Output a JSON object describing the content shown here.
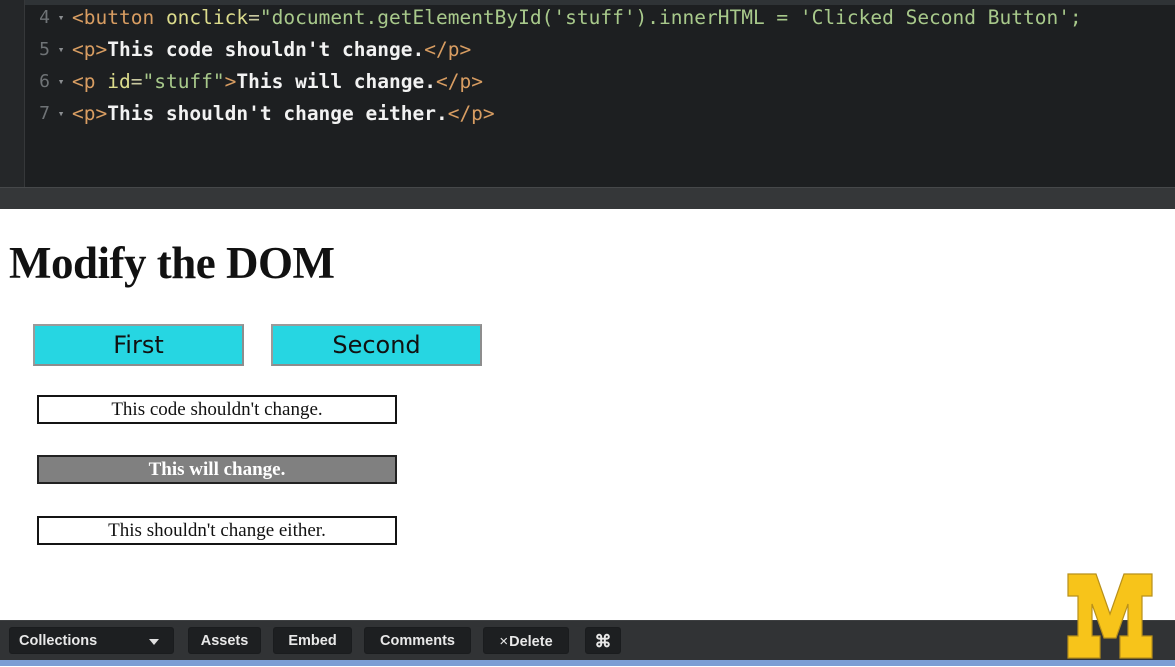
{
  "editor": {
    "lines": [
      {
        "number": "4",
        "fold": "▾",
        "tokens": [
          {
            "type": "tag",
            "text": "<button"
          },
          {
            "type": "text_space",
            "text": " "
          },
          {
            "type": "attr",
            "text": "onclick"
          },
          {
            "type": "op",
            "text": "="
          },
          {
            "type": "str",
            "text": "\"document.getElementById('stuff').innerHTML = 'Clicked Second Button';"
          }
        ],
        "plain": "<button onclick=\"document.getElementById('stuff').innerHTML = 'Clicked Second Button';"
      },
      {
        "number": "5",
        "fold": "▾",
        "tokens": [
          {
            "type": "tag",
            "text": "<p>"
          },
          {
            "type": "text",
            "text": "This code shouldn't change."
          },
          {
            "type": "tag",
            "text": "</p>"
          }
        ],
        "plain": "<p>This code shouldn't change.</p>"
      },
      {
        "number": "6",
        "fold": "▾",
        "tokens": [
          {
            "type": "tag",
            "text": "<p"
          },
          {
            "type": "text_space",
            "text": " "
          },
          {
            "type": "attr",
            "text": "id"
          },
          {
            "type": "op",
            "text": "="
          },
          {
            "type": "str",
            "text": "\"stuff\""
          },
          {
            "type": "tag",
            "text": ">"
          },
          {
            "type": "text",
            "text": "This will change."
          },
          {
            "type": "tag",
            "text": "</p>"
          }
        ],
        "plain": "<p id=\"stuff\">This will change.</p>"
      },
      {
        "number": "7",
        "fold": "▾",
        "tokens": [
          {
            "type": "tag",
            "text": "<p>"
          },
          {
            "type": "text",
            "text": "This shouldn't change either."
          },
          {
            "type": "tag",
            "text": "</p>"
          }
        ],
        "plain": "<p>This shouldn't change either.</p>"
      }
    ],
    "colors": {
      "background": "#1d1f21",
      "gutter": "#252729",
      "tag": "#d89d62",
      "attribute": "#dcdc8c",
      "string": "#a8c98b",
      "text": "#f2f2f2",
      "line_number": "#6f7376"
    }
  },
  "preview": {
    "heading": "Modify the DOM",
    "buttons": [
      {
        "label": "First",
        "name": "first"
      },
      {
        "label": "Second",
        "name": "second"
      }
    ],
    "paragraphs": [
      {
        "text": "This code shouldn't change.",
        "selected": false
      },
      {
        "text": "This will change.",
        "selected": true
      },
      {
        "text": "This shouldn't change either.",
        "selected": false
      }
    ],
    "colors": {
      "button_fill": "#26d6e2",
      "selection_fill": "#808080",
      "background": "#ffffff"
    }
  },
  "logo": {
    "name": "university-of-michigan-m",
    "letter": "M",
    "color": "#f7c41a"
  },
  "toolbar": {
    "collections_label": "Collections",
    "collections_caret": "▾",
    "assets_label": "Assets",
    "embed_label": "Embed",
    "comments_label": "Comments",
    "delete_x": "×",
    "delete_label": "Delete",
    "command_label": "⌘",
    "colors": {
      "background": "#313335",
      "button": "#1d1f21",
      "text": "#e8e8e8",
      "accent_strip": "#7b9dd4"
    }
  }
}
